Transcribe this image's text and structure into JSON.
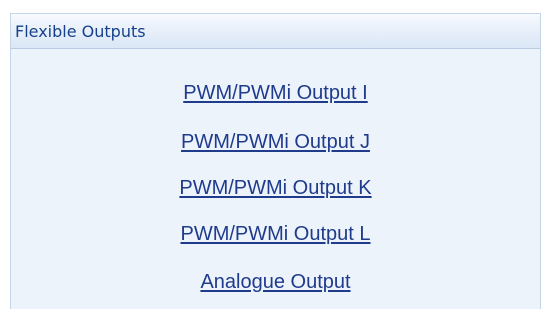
{
  "panel": {
    "title": "Flexible Outputs",
    "links": [
      {
        "label": "PWM/PWMi Output I"
      },
      {
        "label": "PWM/PWMi Output J"
      },
      {
        "label": "PWM/PWMi Output K"
      },
      {
        "label": "PWM/PWMi Output L"
      },
      {
        "label": "Analogue Output"
      }
    ]
  },
  "colors": {
    "header_text": "#15428b",
    "link_text": "#1f3b8c",
    "panel_background": "#edf3fb"
  }
}
